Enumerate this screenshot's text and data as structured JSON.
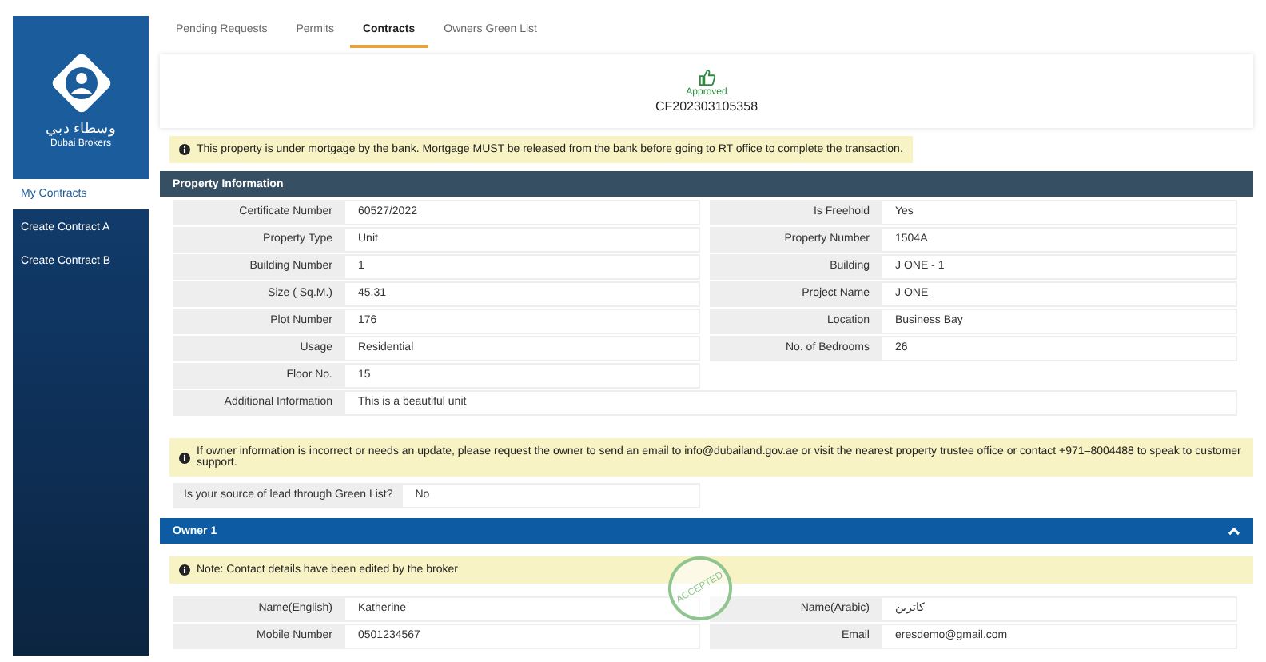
{
  "sidebar": {
    "logo_text_arabic": "وسطاء دبي",
    "logo_text": "Dubai Brokers",
    "items": [
      {
        "label": "My Contracts",
        "selected": true
      },
      {
        "label": "Create Contract A",
        "selected": false
      },
      {
        "label": "Create Contract B",
        "selected": false
      }
    ]
  },
  "tabs": [
    {
      "label": "Pending Requests",
      "selected": false
    },
    {
      "label": "Permits",
      "selected": false
    },
    {
      "label": "Contracts",
      "selected": true
    },
    {
      "label": "Owners Green List",
      "selected": false
    }
  ],
  "status": {
    "label": "Approved",
    "number": "CF202303105358"
  },
  "mortgage_alert": "This property is under mortgage by the bank. Mortgage MUST be released from the bank before going to RT office to complete the transaction.",
  "property": {
    "title": "Property Information",
    "left": [
      {
        "label": "Certificate Number",
        "value": "60527/2022"
      },
      {
        "label": "Property Type",
        "value": "Unit"
      },
      {
        "label": "Building Number",
        "value": "1"
      },
      {
        "label": "Size ( Sq.M.)",
        "value": "45.31"
      },
      {
        "label": "Plot Number",
        "value": "176"
      },
      {
        "label": "Usage",
        "value": "Residential"
      },
      {
        "label": "Floor No.",
        "value": "15"
      }
    ],
    "right": [
      {
        "label": "Is Freehold",
        "value": "Yes"
      },
      {
        "label": "Property Number",
        "value": "1504A"
      },
      {
        "label": "Building",
        "value": "J ONE - 1"
      },
      {
        "label": "Project Name",
        "value": "J ONE"
      },
      {
        "label": "Location",
        "value": "Business Bay"
      },
      {
        "label": "No. of Bedrooms",
        "value": "26"
      }
    ],
    "full": {
      "label": "Additional Information",
      "value": "This is a beautiful unit"
    }
  },
  "owner_alert": "If owner information is incorrect or needs an update, please request the owner to send an email to info@dubailand.gov.ae or visit the nearest property trustee office or contact +971–8004488 to speak to customer support.",
  "green_list": {
    "label": "Is your source of lead through Green List?",
    "value": "No"
  },
  "owner": {
    "title": "Owner 1",
    "expanded": true,
    "note": "Note: Contact details have been edited by the broker",
    "stamp": "ACCEPTED",
    "left": [
      {
        "label": "Name(English)",
        "value": "Katherine"
      },
      {
        "label": "Mobile Number",
        "value": "0501234567"
      }
    ],
    "right": [
      {
        "label": "Name(Arabic)",
        "value": "كاترين"
      },
      {
        "label": "Email",
        "value": "eresdemo@gmail.com"
      }
    ]
  }
}
